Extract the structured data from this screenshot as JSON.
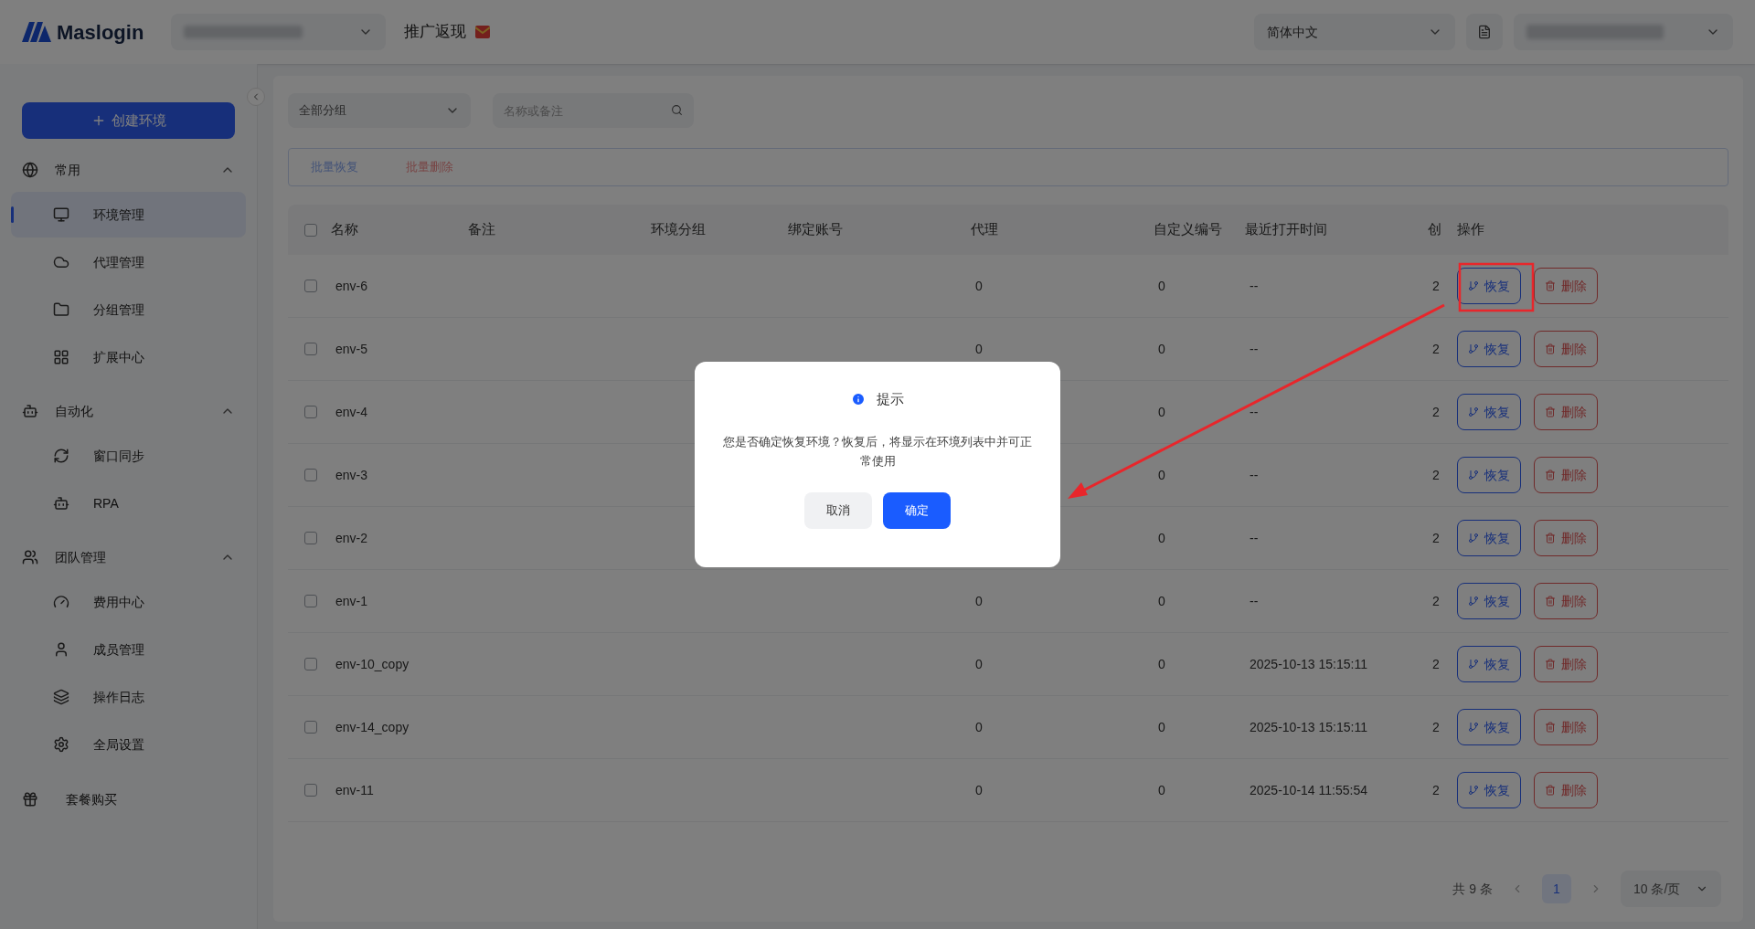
{
  "header": {
    "logo": "Maslogin",
    "promo": "推广返现",
    "language": "简体中文"
  },
  "sidebar": {
    "create_button": "创建环境",
    "sections": [
      {
        "label": "常用",
        "expanded": true,
        "items": [
          {
            "label": "环境管理",
            "selected": true
          },
          {
            "label": "代理管理",
            "selected": false
          },
          {
            "label": "分组管理",
            "selected": false
          },
          {
            "label": "扩展中心",
            "selected": false
          }
        ]
      },
      {
        "label": "自动化",
        "expanded": true,
        "items": [
          {
            "label": "窗口同步",
            "selected": false
          },
          {
            "label": "RPA",
            "selected": false
          }
        ]
      },
      {
        "label": "团队管理",
        "expanded": true,
        "items": [
          {
            "label": "费用中心",
            "selected": false
          },
          {
            "label": "成员管理",
            "selected": false
          },
          {
            "label": "操作日志",
            "selected": false
          },
          {
            "label": "全局设置",
            "selected": false
          }
        ]
      }
    ],
    "footer_item": "套餐购买"
  },
  "filters": {
    "group": "全部分组",
    "search": {
      "placeholder": "名称或备注"
    }
  },
  "batch_actions": [
    "批量恢复",
    "批量删除"
  ],
  "table": {
    "header_checked": false,
    "columns": [
      "名称",
      "备注",
      "环境分组",
      "绑定账号",
      "代理",
      "自定义编号",
      "最近打开时间",
      "创",
      "操作"
    ],
    "rows": [
      {
        "name": "env-6",
        "proxy": "0",
        "custom_id": "0",
        "last_opened": "--",
        "column_9": "2",
        "checked": false,
        "highlighted": true,
        "actions": [
          "恢复",
          "删除"
        ]
      },
      {
        "name": "env-5",
        "proxy": "0",
        "custom_id": "0",
        "last_opened": "--",
        "column_9": "2",
        "checked": false,
        "highlighted": false,
        "actions": [
          "恢复",
          "删除"
        ]
      },
      {
        "name": "env-4",
        "custom_id": "0",
        "last_opened": "--",
        "column_9": "2",
        "checked": false,
        "highlighted": false,
        "actions": [
          "恢复",
          "删除"
        ]
      },
      {
        "name": "env-3",
        "custom_id": "0",
        "last_opened": "--",
        "column_9": "2",
        "checked": false,
        "highlighted": false,
        "actions": [
          "恢复",
          "删除"
        ]
      },
      {
        "name": "env-2",
        "custom_id": "0",
        "last_opened": "--",
        "column_9": "2",
        "checked": false,
        "highlighted": false,
        "actions": [
          "恢复",
          "删除"
        ]
      },
      {
        "name": "env-1",
        "proxy": "0",
        "custom_id": "0",
        "last_opened": "--",
        "column_9": "2",
        "checked": false,
        "highlighted": false,
        "actions": [
          "恢复",
          "删除"
        ]
      },
      {
        "name": "env-10_copy",
        "proxy": "0",
        "custom_id": "0",
        "last_opened": "2025-10-13 15:15:11",
        "column_9": "2",
        "checked": false,
        "highlighted": false,
        "actions": [
          "恢复",
          "删除"
        ]
      },
      {
        "name": "env-14_copy",
        "proxy": "0",
        "custom_id": "0",
        "last_opened": "2025-10-13 15:15:11",
        "column_9": "2",
        "checked": false,
        "highlighted": false,
        "actions": [
          "恢复",
          "删除"
        ]
      },
      {
        "name": "env-11",
        "proxy": "0",
        "custom_id": "0",
        "last_opened": "2025-10-14 11:55:54",
        "column_9": "2",
        "checked": false,
        "highlighted": false,
        "actions": [
          "恢复",
          "删除"
        ]
      }
    ]
  },
  "pagination": {
    "total": "共 9 条",
    "pages": [
      {
        "label": "1",
        "selected": true
      }
    ],
    "page_size": "10 条/页"
  },
  "dialog": {
    "title": "提示",
    "message": "您是否确定恢复环境？恢复后，将显示在环境列表中并可正常使用",
    "cancel": "取消",
    "confirm": "确定"
  }
}
